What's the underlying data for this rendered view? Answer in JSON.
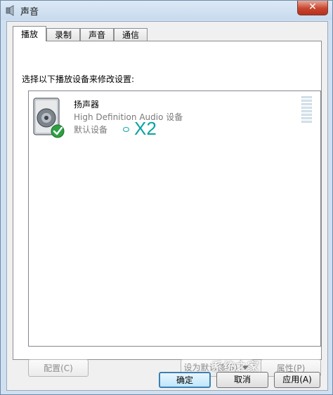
{
  "window": {
    "title": "声音",
    "close_glyph": "✕"
  },
  "tabs": [
    {
      "label": "播放",
      "active": true
    },
    {
      "label": "录制",
      "active": false
    },
    {
      "label": "声音",
      "active": false
    },
    {
      "label": "通信",
      "active": false
    }
  ],
  "instruction": "选择以下播放设备来修改设置:",
  "device": {
    "name": "扬声器",
    "description": "High Definition Audio 设备",
    "status": "默认设备",
    "icon": "speaker-icon",
    "status_icon": "checkmark-icon"
  },
  "annotation": {
    "text": "X2",
    "color": "#0aa3a3"
  },
  "panel_buttons": {
    "configure": "配置(C)",
    "set_default": "设为默认值(S)",
    "properties": "属性(P)"
  },
  "dialog_buttons": {
    "ok": "确定",
    "cancel": "取消",
    "apply": "应用(A)"
  },
  "watermark": "系统之家",
  "colors": {
    "annotation": "#0aa3a3",
    "close": "#c7452e",
    "check": "#2ea043"
  }
}
